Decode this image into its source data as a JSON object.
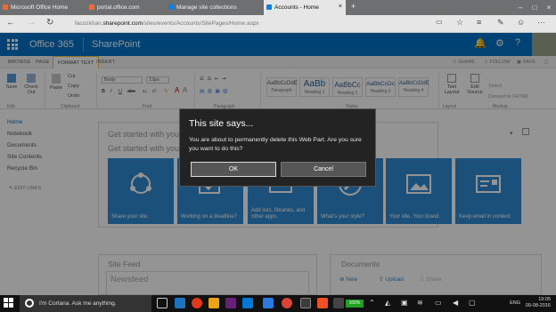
{
  "browser": {
    "tabs": [
      {
        "label": "Microsoft Office Home",
        "active": false
      },
      {
        "label": "portal.office.com",
        "active": false
      },
      {
        "label": "Manage site collections",
        "active": false
      },
      {
        "label": "Accounts - Home",
        "active": true
      }
    ],
    "new_tab": "+",
    "url_prefix": "facozkhan.",
    "url_domain": "sharepoint.com",
    "url_path": "/sites/events/Accounts/SitePages/Home.aspx"
  },
  "suite_bar": {
    "brand": "Office 365",
    "app": "SharePoint",
    "colors": {
      "bar": "#0072c6"
    }
  },
  "ribbon": {
    "tabs": [
      "BROWSE",
      "PAGE",
      "FORMAT TEXT",
      "INSERT"
    ],
    "selected_tab": "FORMAT TEXT",
    "actions": {
      "share": "SHARE",
      "follow": "FOLLOW",
      "save": "SAVE"
    },
    "buttons": {
      "save": "Save",
      "checkout": "Check Out",
      "paste": "Paste",
      "cut": "Cut",
      "copy": "Copy",
      "undo": "Undo"
    },
    "font_name": "Body",
    "font_size": "13px",
    "styles": [
      {
        "sample": "AaBbCcDdE",
        "name": "Paragraph"
      },
      {
        "sample": "AaBb",
        "name": "Heading 1"
      },
      {
        "sample": "AaBbCc",
        "name": "Heading 2"
      },
      {
        "sample": "AaBbCcDc",
        "name": "Heading 3"
      },
      {
        "sample": "AaBbCcDdE",
        "name": "Heading 4"
      }
    ],
    "text_layout": "Text Layout",
    "edit_source": "Edit Source",
    "select": "Select",
    "convert": "Convert to XHTML",
    "groups": {
      "edit": "Edit",
      "clipboard": "Clipboard",
      "font": "Font",
      "paragraph": "Paragraph",
      "styles": "Styles",
      "layout": "Layout",
      "markup": "Markup"
    }
  },
  "left_nav": {
    "items": [
      "Home",
      "Notebook",
      "Documents",
      "Site Contents",
      "Recycle Bin"
    ],
    "edit_links": "EDIT LINKS"
  },
  "content": {
    "get_started_title": "Get started with your site",
    "tiles": [
      {
        "label": "Share your site."
      },
      {
        "label": "Working on a deadline?"
      },
      {
        "label": "Add lists, libraries, and other apps."
      },
      {
        "label": "What's your style?"
      },
      {
        "label": "Your site. Your brand."
      },
      {
        "label": "Keep email in context."
      }
    ],
    "site_feed": "Site Feed",
    "newsfeed": "Newsfeed",
    "documents": "Documents",
    "docs_new": "New",
    "docs_upload": "Upload",
    "docs_share": "Share"
  },
  "dialog": {
    "title": "This site says...",
    "message": "You are about to permanently delete this Web Part. Are you sure you want to do this?",
    "ok": "OK",
    "cancel": "Cancel"
  },
  "taskbar": {
    "cortana": "I'm Cortana. Ask me anything.",
    "battery": "100%",
    "language": "ENG",
    "time": "19:05",
    "date": "09-08-2016"
  }
}
